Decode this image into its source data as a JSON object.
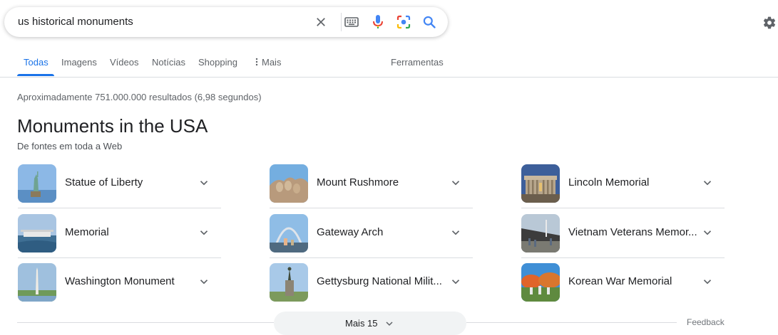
{
  "search": {
    "query": "us historical monuments",
    "icons": [
      "clear-icon",
      "keyboard-icon",
      "voice-search-icon",
      "lens-icon",
      "search-icon"
    ]
  },
  "tabs": [
    {
      "label": "Todas",
      "active": true
    },
    {
      "label": "Imagens"
    },
    {
      "label": "Vídeos"
    },
    {
      "label": "Notícias"
    },
    {
      "label": "Shopping"
    },
    {
      "label": "Mais"
    }
  ],
  "tools_label": "Ferramentas",
  "results_count": "Aproximadamente 751.000.000 resultados (6,98 segundos)",
  "panel": {
    "title": "Monuments in the USA",
    "subtitle": "De fontes em toda a Web",
    "items": [
      {
        "label": "Statue of Liberty"
      },
      {
        "label": "Mount Rushmore"
      },
      {
        "label": "Lincoln Memorial"
      },
      {
        "label": "Memorial"
      },
      {
        "label": "Gateway Arch"
      },
      {
        "label": "Vietnam Veterans Memor..."
      },
      {
        "label": "Washington Monument"
      },
      {
        "label": "Gettysburg National Milit..."
      },
      {
        "label": "Korean War Memorial"
      }
    ],
    "more_label": "Mais 15",
    "feedback_label": "Feedback"
  },
  "colors": {
    "accent": "#1a73e8",
    "text": "#202124",
    "muted": "#5f6368",
    "divider": "#dadce0"
  }
}
